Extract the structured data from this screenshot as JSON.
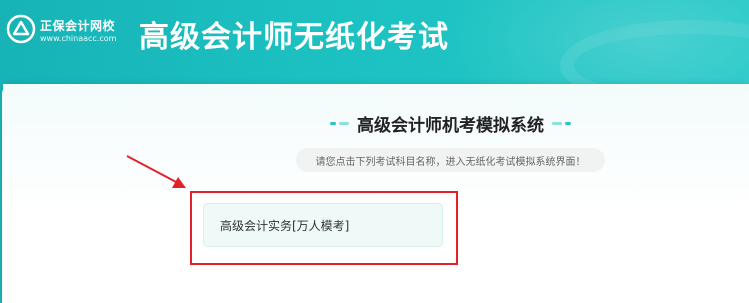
{
  "header": {
    "logo_name": "正保会计网校",
    "logo_url": "www.chinaacc.com",
    "title": "高级会计师无纸化考试"
  },
  "main": {
    "system_title": "高级会计师机考模拟系统",
    "hint": "请您点击下列考试科目名称，进入无纸化考试模拟系统界面！",
    "exam_items": [
      {
        "label": "高级会计实务[万人模考]"
      }
    ]
  },
  "colors": {
    "header_teal": "#1cc0c1",
    "annotation_red": "#e3212a"
  },
  "icons": {
    "logo": "chinaacc-logo-icon",
    "arrow": "annotation-arrow-icon"
  }
}
